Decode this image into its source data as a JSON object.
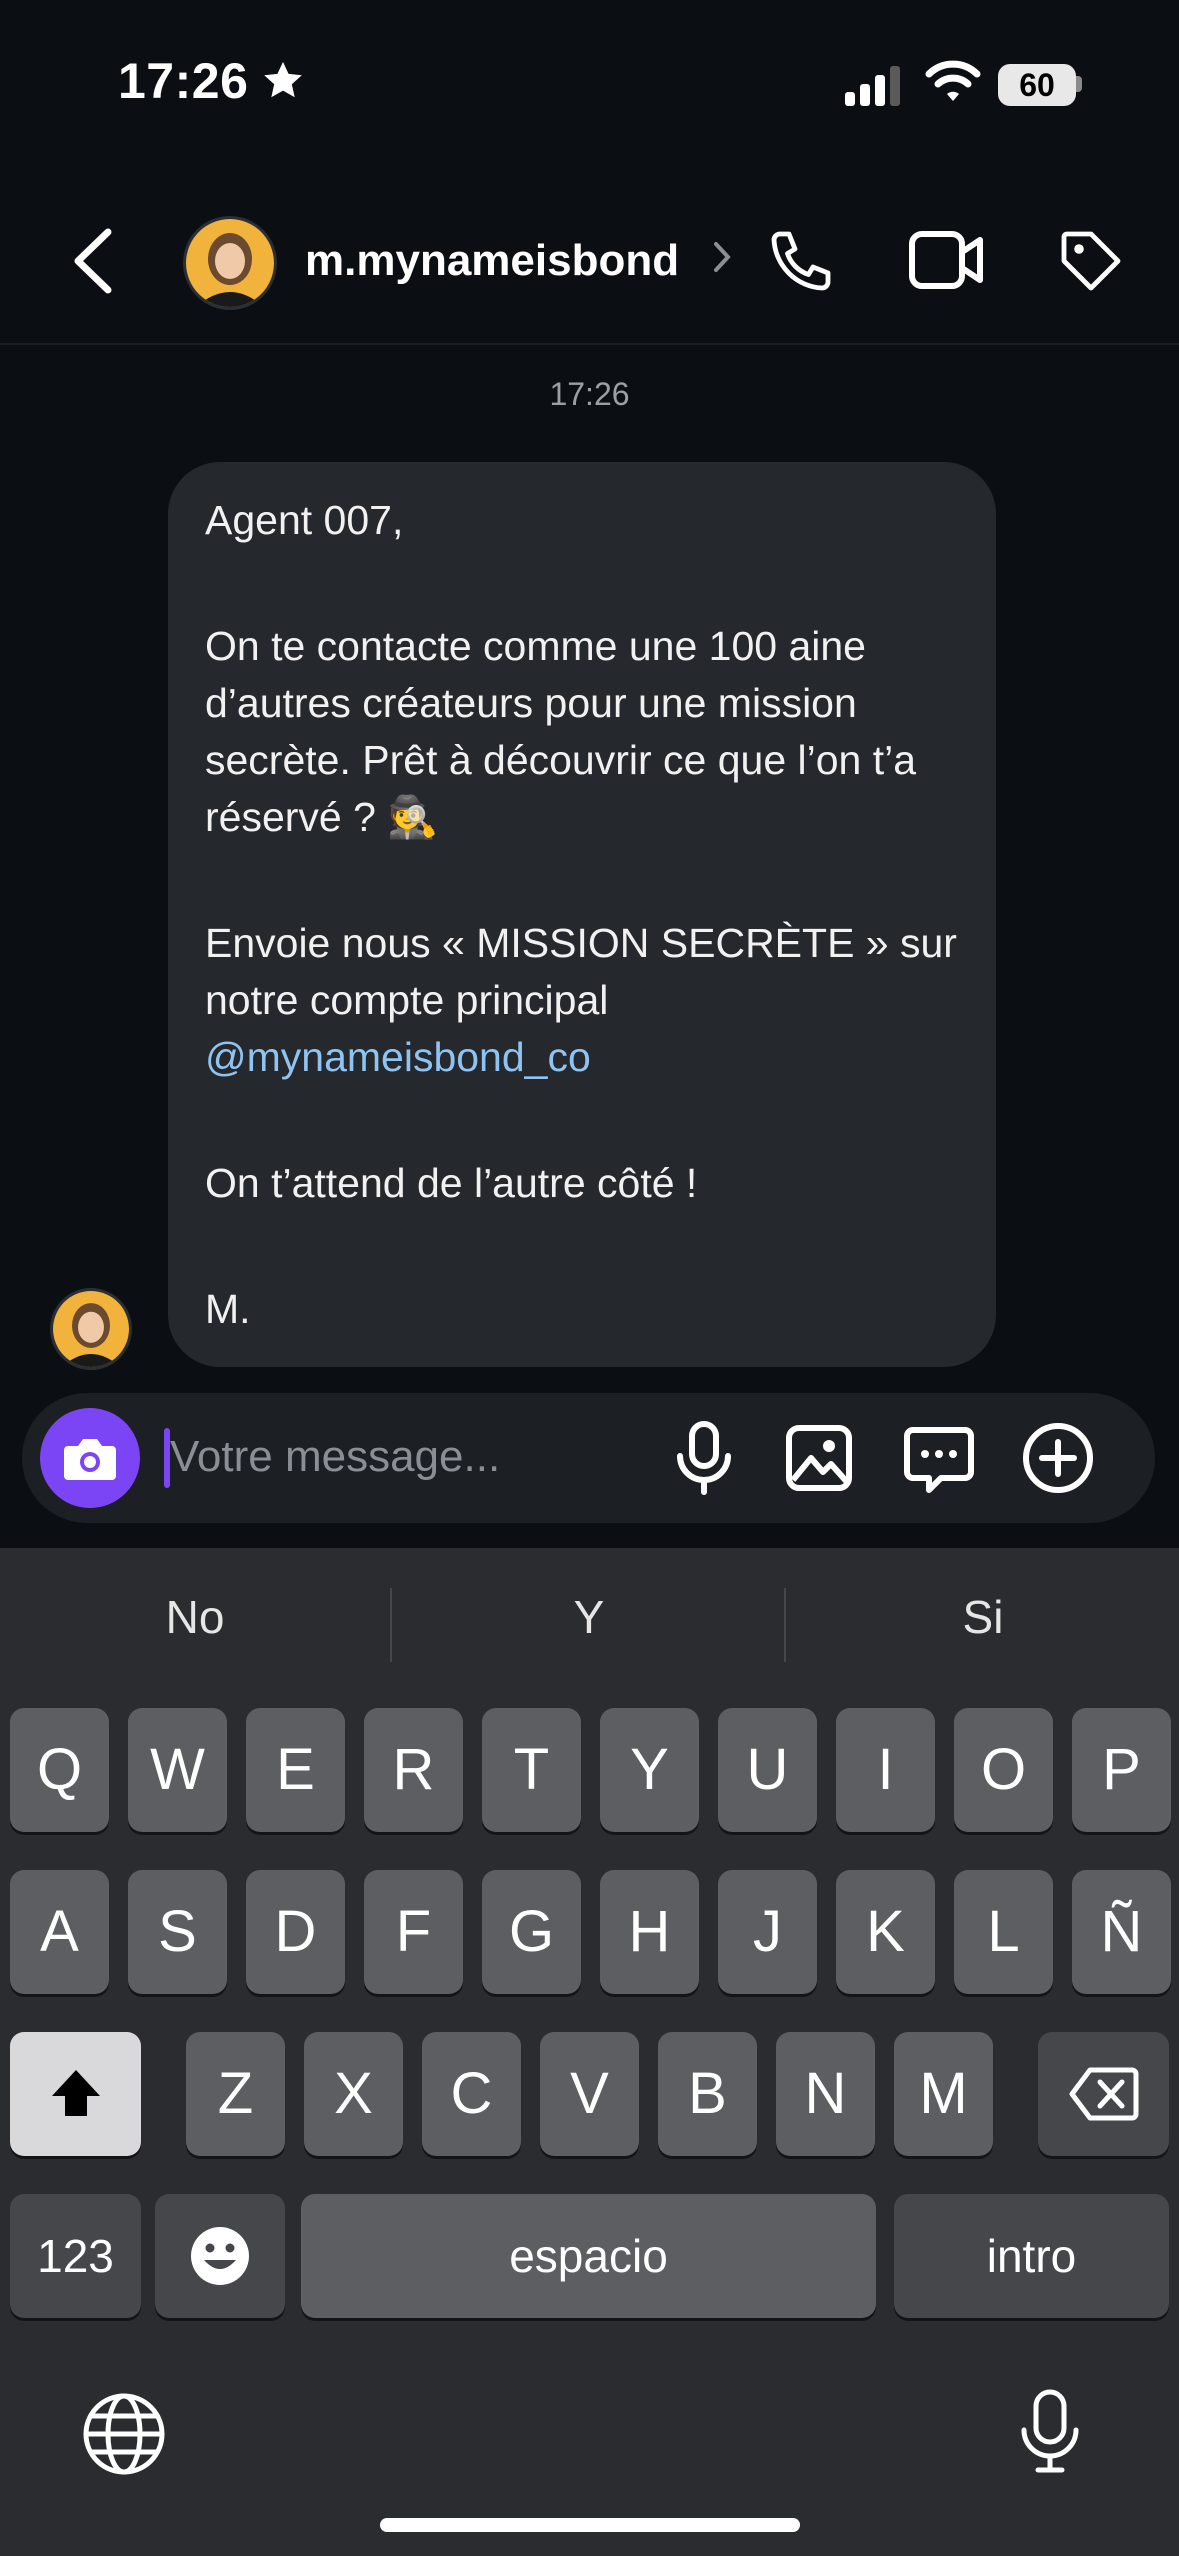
{
  "status_bar": {
    "time": "17:26",
    "battery": "60"
  },
  "header": {
    "username": "m.mynameisbond"
  },
  "chat": {
    "timestamp": "17:26",
    "message": {
      "greeting": "Agent 007,",
      "para1": "On te contacte comme une 100 aine d’autres créateurs pour une mission secrète. Prêt à découvrir ce que l’on t’a réservé ? 🕵️",
      "para2": "Envoie nous « MISSION SECRÈTE » sur notre compte principal",
      "mention": "@mynameisbond_co",
      "para3": "On t’attend de l’autre côté !",
      "signature": "M."
    }
  },
  "composer": {
    "placeholder": "Votre message..."
  },
  "keyboard": {
    "suggestions": [
      "No",
      "Y",
      "Si"
    ],
    "row1": [
      "Q",
      "W",
      "E",
      "R",
      "T",
      "Y",
      "U",
      "I",
      "O",
      "P"
    ],
    "row2": [
      "A",
      "S",
      "D",
      "F",
      "G",
      "H",
      "J",
      "K",
      "L",
      "Ñ"
    ],
    "row3": [
      "Z",
      "X",
      "C",
      "V",
      "B",
      "N",
      "M"
    ],
    "numbers_label": "123",
    "space_label": "espacio",
    "return_label": "intro"
  }
}
